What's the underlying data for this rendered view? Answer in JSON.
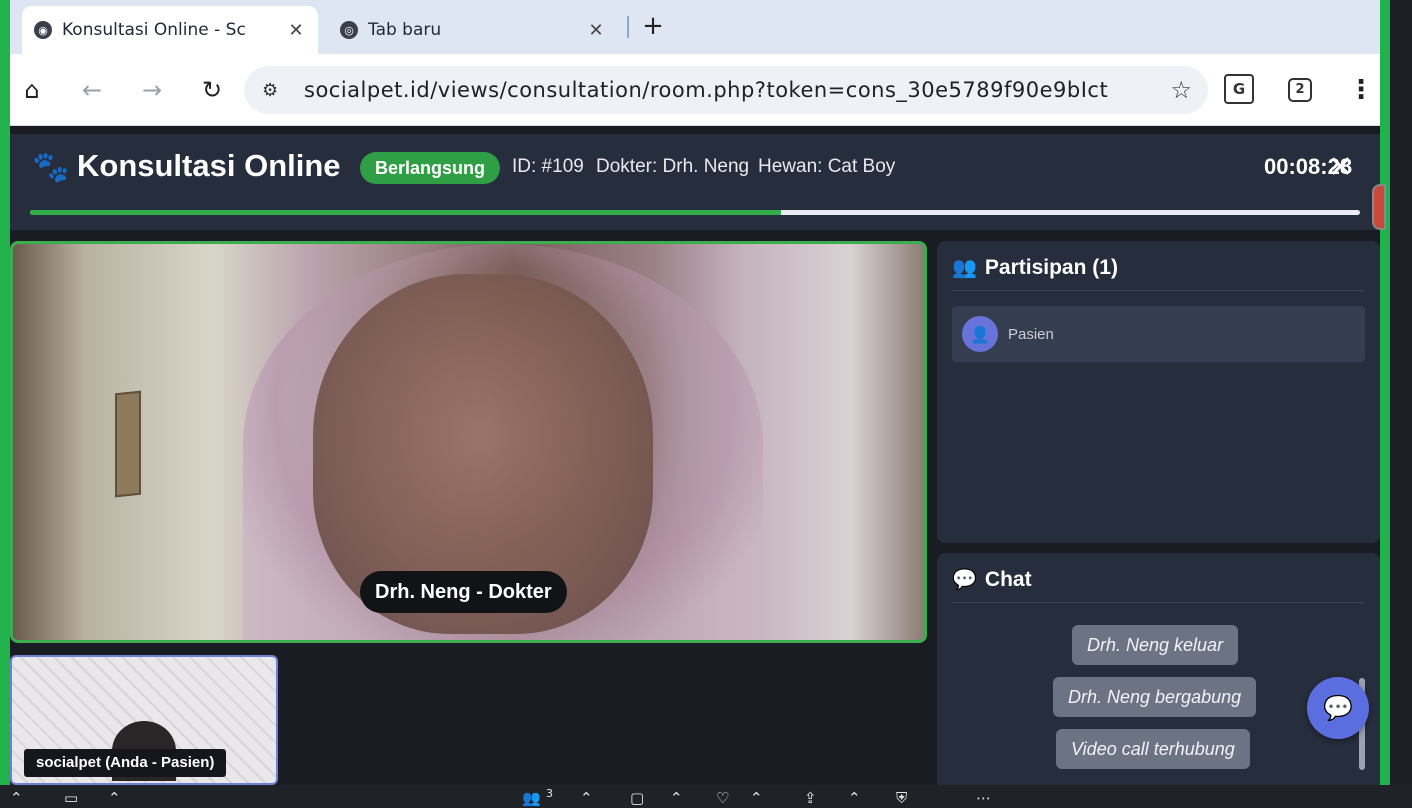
{
  "browser": {
    "tabs": [
      {
        "title": "Konsultasi Online - Sc",
        "active": true,
        "close": "✕"
      },
      {
        "title": "Tab baru",
        "active": false,
        "close": "✕"
      }
    ],
    "new_tab": "+",
    "url": "socialpet.id/views/consultation/room.php?token=cons_30e5789f90e9bIct",
    "tab_count": "2",
    "translate_label": "G"
  },
  "app": {
    "title": "Konsultasi Online",
    "status": "Berlangsung",
    "consultation_id": "ID: #109",
    "doctor": "Dokter: Drh. Neng",
    "pet": "Hewan: Cat Boy",
    "timer": "00:08:28",
    "progress_fraction": 0.565
  },
  "video": {
    "main_label": "Drh. Neng - Dokter",
    "self_label": "socialpet (Anda - Pasien)"
  },
  "participants": {
    "title": "Partisipan (1)",
    "items": [
      {
        "name": "Pasien"
      }
    ]
  },
  "chat": {
    "title": "Chat",
    "messages": [
      "Drh. Neng keluar",
      "Drh. Neng bergabung",
      "Video call terhubung"
    ]
  },
  "taskbar": {
    "participants_count": "3"
  },
  "colors": {
    "accent_green": "#2f9e44",
    "panel_bg": "#262d3d",
    "fab": "#5b6ee0"
  }
}
